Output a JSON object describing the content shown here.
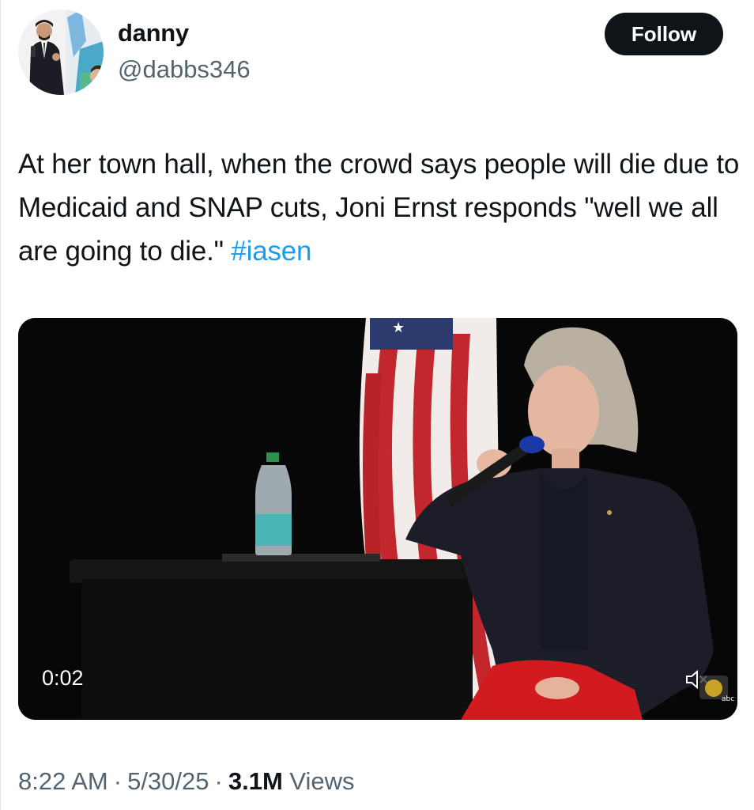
{
  "author": {
    "display_name": "danny",
    "handle": "@dabbs346",
    "avatar_icon": "profile-photo"
  },
  "follow_label": "Follow",
  "tweet": {
    "text": "At her town hall, when the crowd says people will die due to Medicaid and SNAP cuts, Joni Ernst responds \"well we all are going to die.\" ",
    "hashtag": "#iasen"
  },
  "media": {
    "duration": "0:02",
    "mute_icon": "speaker-muted-icon",
    "station_logo": "abc-station-logo"
  },
  "meta": {
    "time": "8:22 AM",
    "separator": "·",
    "date": "5/30/25",
    "views_count": "3.1M",
    "views_label": "Views"
  },
  "colors": {
    "text": "#0f1419",
    "secondary": "#536471",
    "link": "#1d9bf0",
    "button": "#0f1419"
  }
}
